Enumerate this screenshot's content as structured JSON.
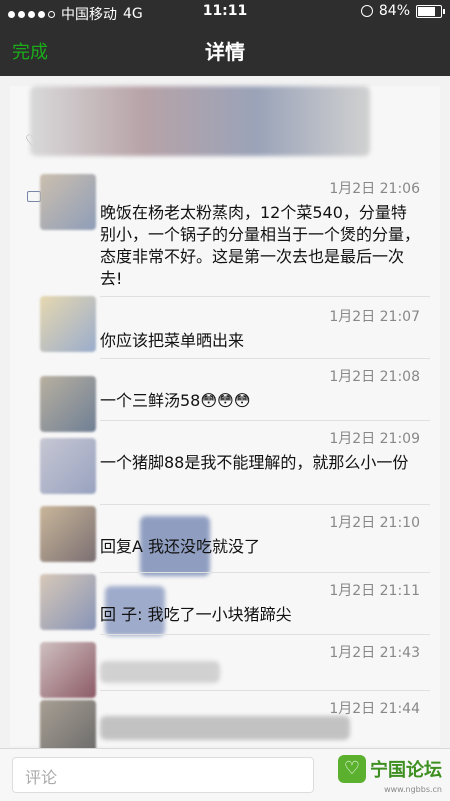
{
  "status_bar": {
    "carrier": "中国移动",
    "network": "4G",
    "time": "11:11",
    "battery": "84%",
    "battery_level": 0.84
  },
  "nav": {
    "done_label": "完成",
    "title": "详情"
  },
  "comments": [
    {
      "time": "1月2日 21:06",
      "text": "晚饭在杨老太粉蒸肉，12个菜540，分量特别小，一个锅子的分量相当于一个煲的分量，态度非常不好。这是第一次去也是最后一次去!"
    },
    {
      "time": "1月2日 21:07",
      "text": "你应该把菜单晒出来"
    },
    {
      "time": "1月2日 21:08",
      "text": "一个三鲜汤58😳😳😳"
    },
    {
      "time": "1月2日 21:09",
      "text": "一个猪脚88是我不能理解的，就那么小一份"
    },
    {
      "time": "1月2日 21:10",
      "text": "回复A  我还没吃就没了"
    },
    {
      "time": "1月2日 21:11",
      "text": "回  子: 我吃了一小块猪蹄尖"
    },
    {
      "time": "1月2日 21:43",
      "text": ""
    },
    {
      "time": "1月2日 21:44",
      "text": ""
    }
  ],
  "bottom": {
    "comment_placeholder": "评论",
    "watermark_text": "宁国论坛",
    "watermark_url": "www.ngbbs.cn"
  },
  "colors": {
    "bar_bg": "#2e2e2e",
    "accent_green": "#1aad19"
  }
}
